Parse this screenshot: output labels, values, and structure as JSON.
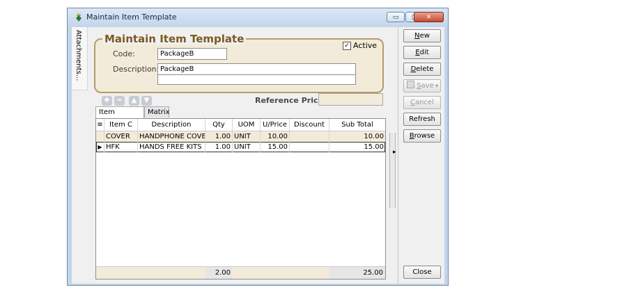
{
  "window": {
    "title": "Maintain Item Template",
    "controls": {
      "minimize": "▭",
      "maximize": "▢",
      "close": "✕"
    }
  },
  "side_tab": {
    "label": "Attachments..."
  },
  "form": {
    "group_title": "Maintain Item Template",
    "code_label": "Code:",
    "code_value": "PackageB",
    "description_label": "Description:",
    "description_value": "PackageB",
    "description2_value": "",
    "active_label": "Active",
    "active_checked": true,
    "reference_price_label": "Reference Price:",
    "reference_price_value": ""
  },
  "toolbar": {
    "add_icon": "plus-icon",
    "remove_icon": "minus-icon",
    "up_icon": "arrow-up-icon",
    "down_icon": "arrow-down-icon"
  },
  "tabs": [
    {
      "label": "Item Template",
      "active": true
    },
    {
      "label": "Matrix",
      "active": false
    }
  ],
  "grid": {
    "columns": [
      "Item C",
      "Description",
      "Qty",
      "UOM",
      "U/Price",
      "Discount",
      "Sub Total"
    ],
    "rows": [
      {
        "item": "COVER",
        "description": "HANDPHONE COVER",
        "qty": "1.00",
        "uom": "UNIT",
        "uprice": "10.00",
        "discount": "",
        "subtotal": "10.00",
        "current": false
      },
      {
        "item": "HFK",
        "description": "HANDS FREE KITS",
        "qty": "1.00",
        "uom": "UNIT",
        "uprice": "15.00",
        "discount": "",
        "subtotal": "15.00",
        "current": true
      }
    ],
    "footer": {
      "qty_total": "2.00",
      "subtotal_total": "25.00"
    }
  },
  "actions": {
    "new": {
      "accel": "N",
      "rest": "ew"
    },
    "edit": {
      "accel": "E",
      "rest": "dit"
    },
    "delete": {
      "accel": "D",
      "rest": "elete"
    },
    "save": {
      "accel": "S",
      "rest": "ave"
    },
    "cancel": {
      "accel": "C",
      "rest": "ancel"
    },
    "refresh": "Refresh",
    "browse": {
      "accel": "B",
      "rest": "rowse"
    },
    "close": "Close"
  },
  "colors": {
    "accent": "#b49b6c",
    "panel": "#f3ebd9",
    "title_text": "#7a5a22"
  }
}
